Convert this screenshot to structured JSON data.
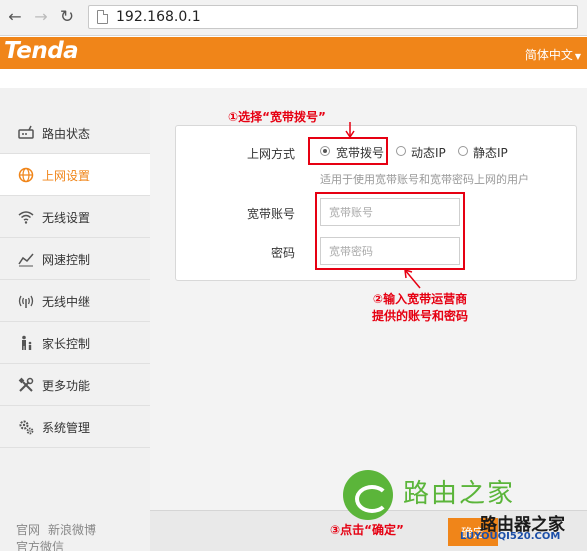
{
  "browser": {
    "address": "192.168.0.1",
    "back_icon": "back-arrow-icon",
    "forward_icon": "forward-arrow-icon",
    "reload_icon": "reload-icon"
  },
  "header": {
    "logo": "Tenda",
    "language": "简体中文",
    "brand_color": "#f08519"
  },
  "sidebar": {
    "items": [
      {
        "label": "路由状态",
        "icon": "router-status-icon",
        "active": false
      },
      {
        "label": "上网设置",
        "icon": "globe-icon",
        "active": true
      },
      {
        "label": "无线设置",
        "icon": "wifi-icon",
        "active": false
      },
      {
        "label": "网速控制",
        "icon": "speed-chart-icon",
        "active": false
      },
      {
        "label": "无线中继",
        "icon": "repeater-icon",
        "active": false
      },
      {
        "label": "家长控制",
        "icon": "parent-child-icon",
        "active": false
      },
      {
        "label": "更多功能",
        "icon": "tools-icon",
        "active": false
      },
      {
        "label": "系统管理",
        "icon": "gears-icon",
        "active": false
      }
    ],
    "footer_links": [
      "官网",
      "新浪微博"
    ],
    "footer_links_row2": [
      "官方微信"
    ]
  },
  "form": {
    "connection_label": "上网方式",
    "options": [
      {
        "label": "宽带拨号",
        "checked": true
      },
      {
        "label": "动态IP",
        "checked": false
      },
      {
        "label": "静态IP",
        "checked": false
      }
    ],
    "hint": "适用于使用宽带账号和宽带密码上网的用户",
    "account_label": "宽带账号",
    "account_placeholder": "宽带账号",
    "password_label": "密码",
    "password_placeholder": "宽带密码"
  },
  "annotations": {
    "step1": "①选择“宽带拨号”",
    "step2_line1": "②输入宽带运营商",
    "step2_line2": "提供的账号和密码",
    "step3": "③点击“确定”",
    "annotation_color": "#e60012"
  },
  "footer": {
    "confirm_label": "确定"
  },
  "watermark": {
    "title": "路由之家",
    "title2": "路由器之家",
    "url": "LUYOUQI520.COM"
  }
}
